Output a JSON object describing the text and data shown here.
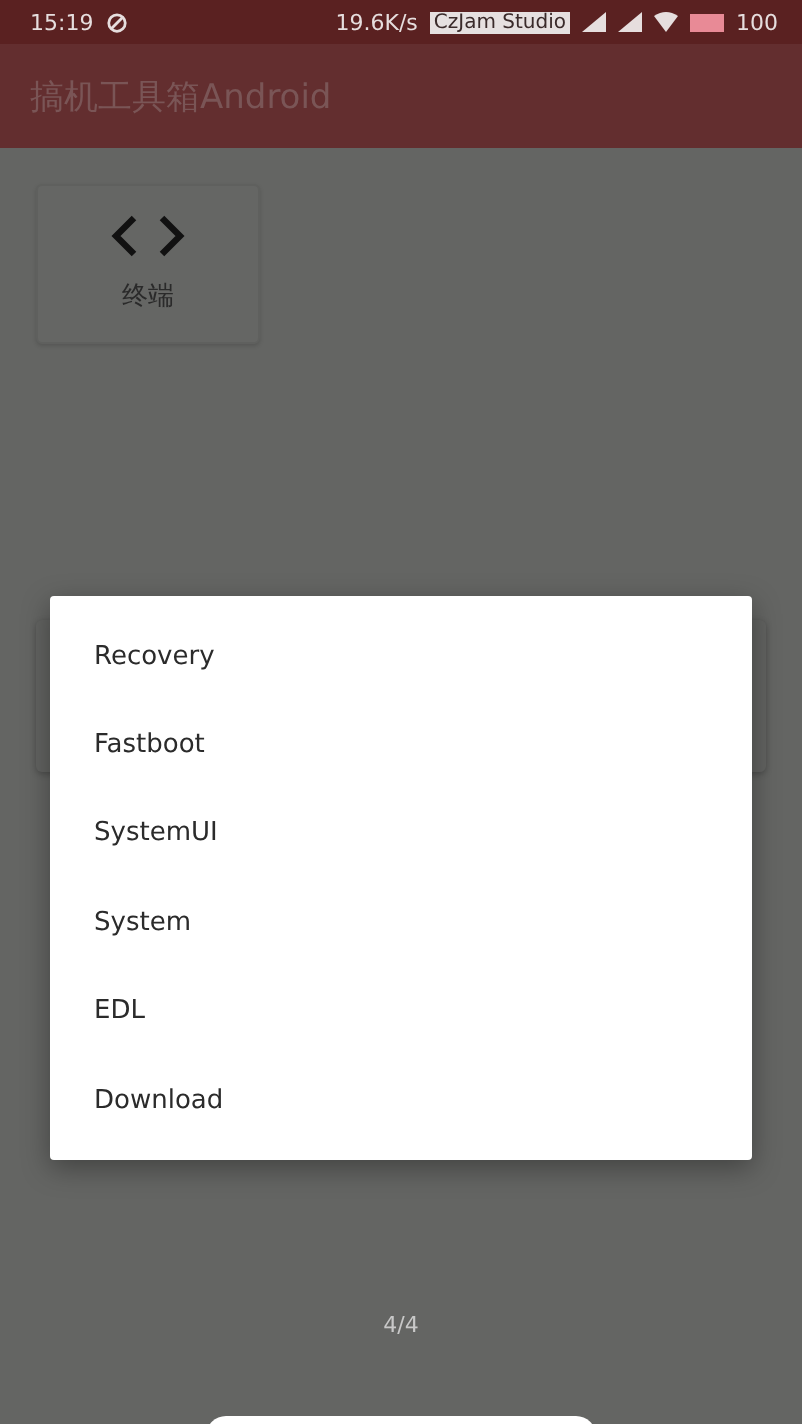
{
  "status_bar": {
    "time": "15:19",
    "net_speed": "19.6K/s",
    "carrier_badge": "CzJam Studio",
    "battery": "100"
  },
  "app_bar": {
    "title": "搞机工具箱Android"
  },
  "tools": [
    {
      "label": "终端"
    }
  ],
  "dialog": {
    "items": [
      {
        "label": "Recovery"
      },
      {
        "label": "Fastboot"
      },
      {
        "label": "SystemUI"
      },
      {
        "label": "System"
      },
      {
        "label": "EDL"
      },
      {
        "label": "Download"
      }
    ]
  },
  "page_indicator": "4/4"
}
